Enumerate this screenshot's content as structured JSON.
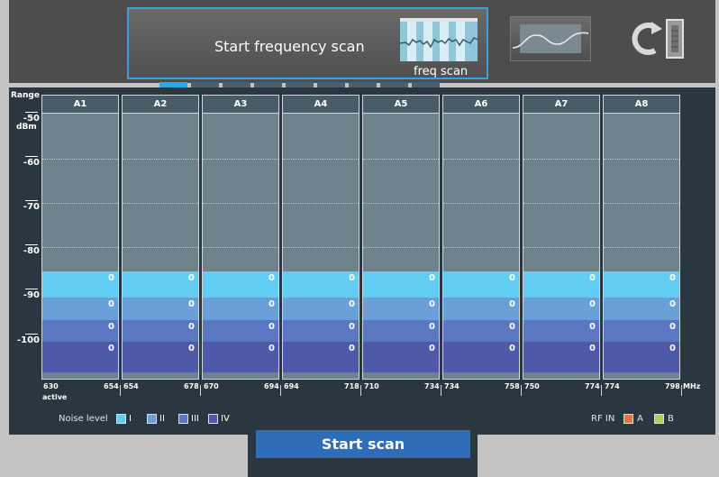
{
  "scan_mode": {
    "title": "Start frequency scan",
    "subtitle": "freq scan"
  },
  "page_indicator": {
    "count": 9,
    "active_index": 0
  },
  "axis": {
    "title": "Range",
    "unit": "dBm",
    "ticks": [
      "-50",
      "-60",
      "-70",
      "-80",
      "-90",
      "-100"
    ]
  },
  "channels": [
    {
      "name": "A1",
      "freq_start": "630",
      "freq_end": "654",
      "values": [
        "0",
        "0",
        "0",
        "0"
      ]
    },
    {
      "name": "A2",
      "freq_start": "654",
      "freq_end": "678",
      "values": [
        "0",
        "0",
        "0",
        "0"
      ]
    },
    {
      "name": "A3",
      "freq_start": "670",
      "freq_end": "694",
      "values": [
        "0",
        "0",
        "0",
        "0"
      ]
    },
    {
      "name": "A4",
      "freq_start": "694",
      "freq_end": "718",
      "values": [
        "0",
        "0",
        "0",
        "0"
      ]
    },
    {
      "name": "A5",
      "freq_start": "710",
      "freq_end": "734",
      "values": [
        "0",
        "0",
        "0",
        "0"
      ]
    },
    {
      "name": "A6",
      "freq_start": "734",
      "freq_end": "758",
      "values": [
        "0",
        "0",
        "0",
        "0"
      ]
    },
    {
      "name": "A7",
      "freq_start": "750",
      "freq_end": "774",
      "values": [
        "0",
        "0",
        "0",
        "0"
      ]
    },
    {
      "name": "A8",
      "freq_start": "774",
      "freq_end": "798",
      "values": [
        "0",
        "0",
        "0",
        "0"
      ]
    }
  ],
  "freq_unit": "MHz",
  "active_label": "active",
  "noise_legend": {
    "label": "Noise level",
    "levels": [
      {
        "name": "I",
        "color": "#62cdf2"
      },
      {
        "name": "II",
        "color": "#6a9fd8"
      },
      {
        "name": "III",
        "color": "#5a78c2"
      },
      {
        "name": "IV",
        "color": "#4e5aa8"
      }
    ]
  },
  "rf_in": {
    "label": "RF IN",
    "inputs": [
      {
        "name": "A",
        "color": "#e8704a"
      },
      {
        "name": "B",
        "color": "#a6d25c"
      }
    ]
  },
  "start_button": {
    "label": "Start scan"
  }
}
